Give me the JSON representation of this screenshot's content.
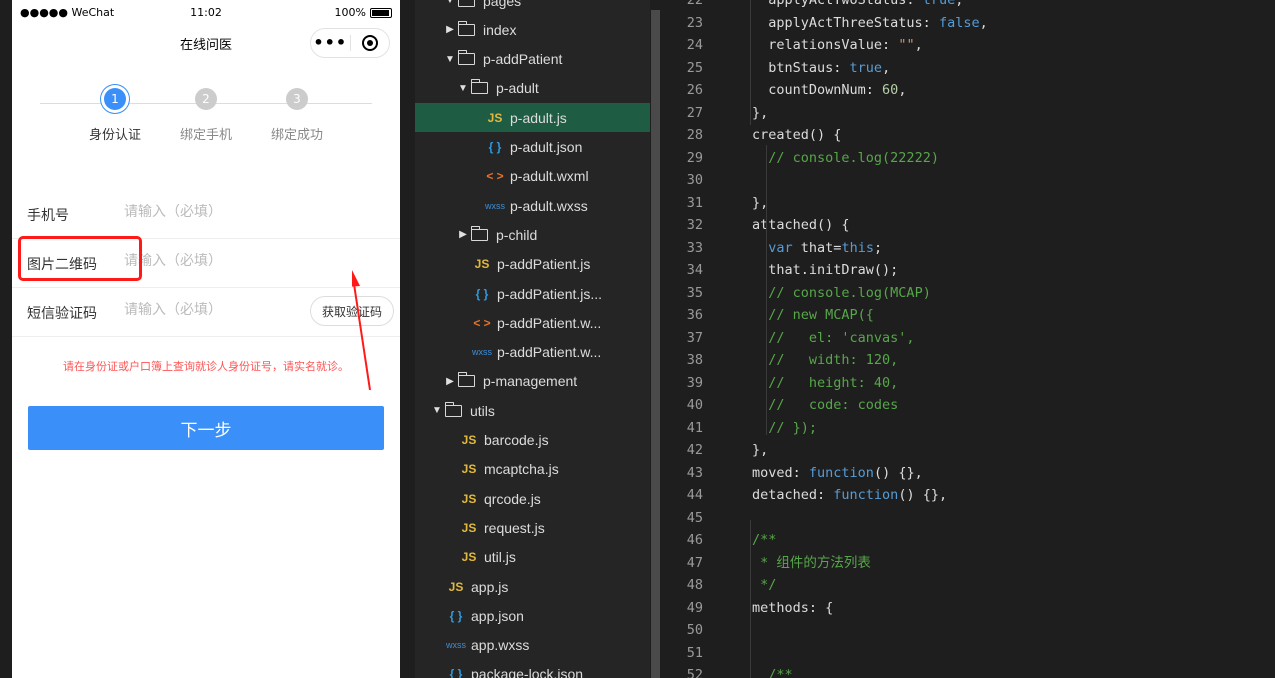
{
  "phone": {
    "status": {
      "carrier": "●●●●● WeChat",
      "time": "11:02",
      "battery": "100%"
    },
    "nav_title": "在线问医",
    "capsule_more": "•••",
    "steps": [
      {
        "num": "1",
        "label": "身份认证",
        "active": true
      },
      {
        "num": "2",
        "label": "绑定手机",
        "active": false
      },
      {
        "num": "3",
        "label": "绑定成功",
        "active": false
      }
    ],
    "form": {
      "phone_label": "手机号",
      "phone_placeholder": "请输入（必填）",
      "captcha_label": "图片二维码",
      "captcha_placeholder": "请输入（必填）",
      "sms_label": "短信验证码",
      "sms_placeholder": "请输入（必填）",
      "get_code": "获取验证码"
    },
    "notice": "请在身份证或户口簿上查询就诊人身份证号，请实名就诊。",
    "next_button": "下一步"
  },
  "tree": {
    "items": [
      {
        "name": "pages",
        "kind": "folder",
        "open": true
      },
      {
        "name": "index",
        "kind": "folder",
        "open": false
      },
      {
        "name": "p-addPatient",
        "kind": "folder",
        "open": true
      },
      {
        "name": "p-adult",
        "kind": "folder",
        "open": true
      },
      {
        "name": "p-adult.js",
        "kind": "js"
      },
      {
        "name": "p-adult.json",
        "kind": "json"
      },
      {
        "name": "p-adult.wxml",
        "kind": "wxml"
      },
      {
        "name": "p-adult.wxss",
        "kind": "wxss"
      },
      {
        "name": "p-child",
        "kind": "folder",
        "open": false
      },
      {
        "name": "p-addPatient.js",
        "kind": "js"
      },
      {
        "name": "p-addPatient.js...",
        "kind": "json"
      },
      {
        "name": "p-addPatient.w...",
        "kind": "wxml"
      },
      {
        "name": "p-addPatient.w...",
        "kind": "wxss"
      },
      {
        "name": "p-management",
        "kind": "folder",
        "open": false
      },
      {
        "name": "utils",
        "kind": "folder",
        "open": true
      },
      {
        "name": "barcode.js",
        "kind": "js"
      },
      {
        "name": "mcaptcha.js",
        "kind": "js"
      },
      {
        "name": "qrcode.js",
        "kind": "js"
      },
      {
        "name": "request.js",
        "kind": "js"
      },
      {
        "name": "util.js",
        "kind": "js"
      },
      {
        "name": "app.js",
        "kind": "js"
      },
      {
        "name": "app.json",
        "kind": "json"
      },
      {
        "name": "app.wxss",
        "kind": "wxss"
      },
      {
        "name": "package-lock.json",
        "kind": "json"
      }
    ],
    "selected": "p-adult.js",
    "icons": {
      "js": "JS",
      "json": "{ }",
      "wxml": "< >",
      "wxss": "wxss"
    }
  },
  "editor": {
    "lines": [
      {
        "n": "22",
        "t": "  applyActTwoStatus: true,"
      },
      {
        "n": "23",
        "t": "  applyActThreeStatus: false,"
      },
      {
        "n": "24",
        "t": "  relationsValue: \"\","
      },
      {
        "n": "25",
        "t": "  btnStaus: true,"
      },
      {
        "n": "26",
        "t": "  countDownNum: 60,"
      },
      {
        "n": "27",
        "t": "},"
      },
      {
        "n": "28",
        "t": "created() {"
      },
      {
        "n": "29",
        "t": "  // console.log(22222)"
      },
      {
        "n": "30",
        "t": ""
      },
      {
        "n": "31",
        "t": "},"
      },
      {
        "n": "32",
        "t": "attached() {"
      },
      {
        "n": "33",
        "t": "  var that=this;"
      },
      {
        "n": "34",
        "t": "  that.initDraw();"
      },
      {
        "n": "35",
        "t": "  // console.log(MCAP)"
      },
      {
        "n": "36",
        "t": "  // new MCAP({"
      },
      {
        "n": "37",
        "t": "  //   el: 'canvas',"
      },
      {
        "n": "38",
        "t": "  //   width: 120,"
      },
      {
        "n": "39",
        "t": "  //   height: 40,"
      },
      {
        "n": "40",
        "t": "  //   code: codes"
      },
      {
        "n": "41",
        "t": "  // });"
      },
      {
        "n": "42",
        "t": "},"
      },
      {
        "n": "43",
        "t": "moved: function() {},"
      },
      {
        "n": "44",
        "t": "detached: function() {},"
      },
      {
        "n": "45",
        "t": ""
      },
      {
        "n": "46",
        "t": "/**"
      },
      {
        "n": "47",
        "t": " * 组件的方法列表"
      },
      {
        "n": "48",
        "t": " */"
      },
      {
        "n": "49",
        "t": "methods: {"
      },
      {
        "n": "50",
        "t": ""
      },
      {
        "n": "51",
        "t": ""
      },
      {
        "n": "52",
        "t": "  /**"
      }
    ]
  },
  "colors": {
    "accent": "#3b8ff8",
    "highlight": "#ff1a1a",
    "tree_selected": "#1f5c44",
    "keyword": "#569cd6",
    "string": "#ce9178",
    "comment": "#57a64a",
    "number": "#b5cea8"
  }
}
